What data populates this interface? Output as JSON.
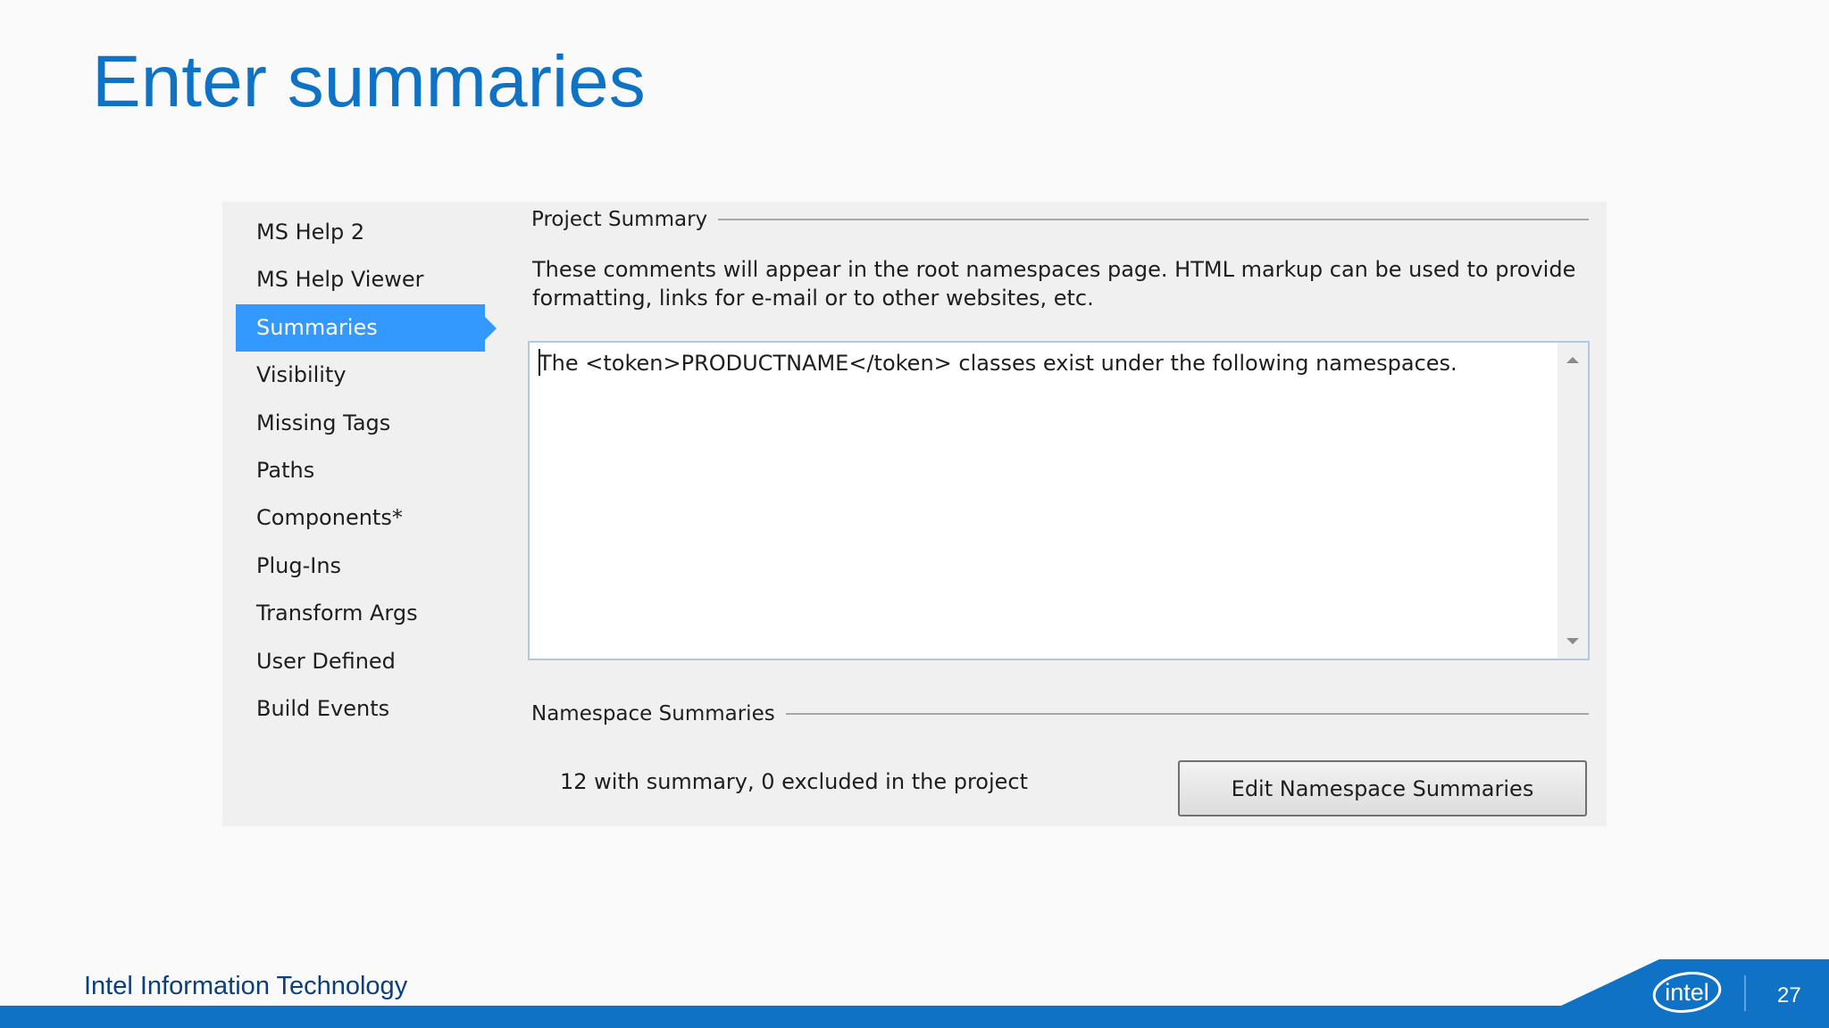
{
  "slide": {
    "title": "Enter summaries",
    "footer_text": "Intel Information Technology",
    "page_number": "27",
    "logo_text": "intel"
  },
  "colors": {
    "accent_blue": "#0f72c4",
    "nav_selected": "#3399ff",
    "panel_background": "#f0f0f0"
  },
  "sidebar": {
    "items": [
      {
        "label": "MS Help 2"
      },
      {
        "label": "MS Help Viewer"
      },
      {
        "label": "Summaries",
        "selected": true
      },
      {
        "label": "Visibility"
      },
      {
        "label": "Missing Tags"
      },
      {
        "label": "Paths"
      },
      {
        "label": "Components*"
      },
      {
        "label": "Plug-Ins"
      },
      {
        "label": "Transform Args"
      },
      {
        "label": "User Defined"
      },
      {
        "label": "Build Events"
      }
    ]
  },
  "project_summary": {
    "group_label": "Project Summary",
    "description_line1": "These comments will appear in the root namespaces page.  HTML markup can be used to provide",
    "description_line2": "formatting, links for e-mail or to other websites, etc.",
    "text_value": "The <token>PRODUCTNAME</token>  classes exist under the following namespaces."
  },
  "namespace_summaries": {
    "group_label": "Namespace Summaries",
    "count_text": "12 with summary, 0 excluded in the project",
    "edit_button_label": "Edit Namespace Summaries"
  }
}
